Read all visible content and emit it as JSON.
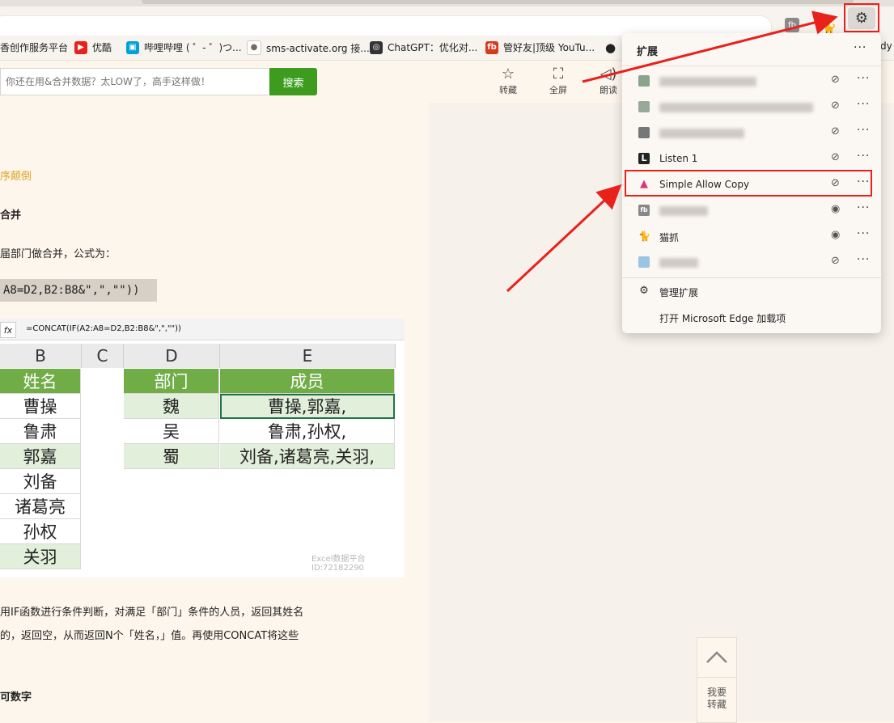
{
  "browser": {
    "bookmarks": [
      {
        "label": "香创作服务平台",
        "icon": "",
        "color": ""
      },
      {
        "label": "优酷",
        "icon": "▶",
        "color": "#e8211b"
      },
      {
        "label": "哔哩哔哩 ( ゜- ゜)つ...",
        "icon": "tv",
        "color": "#00a1d6"
      },
      {
        "label": "sms-activate.org 接...",
        "icon": "●",
        "color": "#7a6a5e"
      },
      {
        "label": "ChatGPT：优化对...",
        "icon": "◎",
        "color": "#333333"
      },
      {
        "label": "管好友|顶级 YouTu...",
        "icon": "fb",
        "color": "#d63a1f"
      }
    ],
    "bookmark_partial_right": "dy -"
  },
  "page_header": {
    "search_placeholder": "你还在用&合并数据？太LOW了，高手这样做！",
    "search_button": "搜索",
    "actions": [
      {
        "label": "转藏",
        "icon": "☆"
      },
      {
        "label": "全屏",
        "icon": "⛶"
      },
      {
        "label": "朗读",
        "icon": "🔈"
      }
    ]
  },
  "article": {
    "subtitle_orange": "序颠倒",
    "heading_merge": "合并",
    "para_1": "届部门做合并，公式为：",
    "formula_highlight": "A8=D2,B2:B8&\",\",\"\"))",
    "sheet": {
      "formula_bar": "=CONCAT(IF(A2:A8=D2,B2:B8&\",\",\"\"))",
      "fx": "fx",
      "col_headers": [
        "B",
        "C",
        "D",
        "E"
      ],
      "col_b": [
        "姓名",
        "曹操",
        "鲁肃",
        "郭嘉",
        "刘备",
        "诸葛亮",
        "孙权",
        "关羽"
      ],
      "col_d": [
        "部门",
        "魏",
        "吴",
        "蜀"
      ],
      "col_e": [
        "成员",
        "曹操,郭嘉,",
        "鲁肃,孙权,",
        "刘备,诸葛亮,关羽,"
      ],
      "watermark_1": "Excel数据平台",
      "watermark_2": "ID:72182290"
    },
    "para_2_line1": "用IF函数进行条件判断，对满足「部门」条件的人员，返回其姓名",
    "para_2_line2": "的，返回空，从而返回N个「姓名，」值。再使用CONCAT将这些",
    "heading_bottom": "可数字"
  },
  "extensions_popup": {
    "title": "扩展",
    "more": "···",
    "items": [
      {
        "name": "",
        "icon_color": "#8aa58a",
        "visible": false
      },
      {
        "name": "",
        "icon_color": "#9aa89a",
        "visible": false
      },
      {
        "name": "",
        "icon_color": "#777777",
        "visible": false
      },
      {
        "name": "Listen 1",
        "icon_color": "#222222",
        "visible": false
      },
      {
        "name": "Simple Allow Copy",
        "icon_color": "#e0327a",
        "visible": false
      },
      {
        "name": "",
        "icon_color": "#888888",
        "visible": true
      },
      {
        "name": "猫抓",
        "icon_color": "#f0b400",
        "visible": true
      },
      {
        "name": "",
        "icon_color": "#9cc4e4",
        "visible": false
      }
    ],
    "manage": "管理扩展",
    "open_addons": "打开 Microsoft Edge 加载项"
  },
  "back_to_top": {
    "label_1": "我要",
    "label_2": "转藏"
  },
  "colors": {
    "accent_red": "#e8211b",
    "search_green": "#3d9c1e",
    "sheet_green": "#70ad47",
    "sheet_alt": "#e2efda"
  }
}
